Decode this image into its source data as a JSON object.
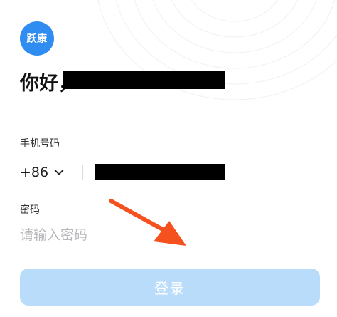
{
  "app": {
    "logo_text": "跃康"
  },
  "greeting": {
    "text": "你好，"
  },
  "phone": {
    "label": "手机号码",
    "country_code": "+86"
  },
  "password": {
    "label": "密码",
    "placeholder": "请输入密码",
    "value": ""
  },
  "actions": {
    "login_label": "登录"
  },
  "colors": {
    "brand": "#2f8cf0",
    "button_disabled": "#b9dcfb",
    "annotation_arrow": "#f4511e"
  },
  "icons": {
    "country_dropdown": "chevron-down-icon",
    "annotation": "arrow-annotation"
  }
}
